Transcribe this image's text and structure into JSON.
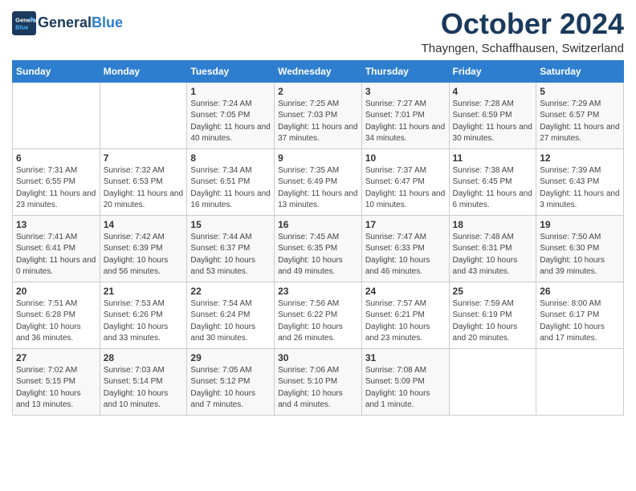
{
  "header": {
    "logo_line1": "General",
    "logo_line2": "Blue",
    "month": "October 2024",
    "location": "Thayngen, Schaffhausen, Switzerland"
  },
  "days_of_week": [
    "Sunday",
    "Monday",
    "Tuesday",
    "Wednesday",
    "Thursday",
    "Friday",
    "Saturday"
  ],
  "weeks": [
    [
      {
        "day": "",
        "info": ""
      },
      {
        "day": "",
        "info": ""
      },
      {
        "day": "1",
        "info": "Sunrise: 7:24 AM\nSunset: 7:05 PM\nDaylight: 11 hours and 40 minutes."
      },
      {
        "day": "2",
        "info": "Sunrise: 7:25 AM\nSunset: 7:03 PM\nDaylight: 11 hours and 37 minutes."
      },
      {
        "day": "3",
        "info": "Sunrise: 7:27 AM\nSunset: 7:01 PM\nDaylight: 11 hours and 34 minutes."
      },
      {
        "day": "4",
        "info": "Sunrise: 7:28 AM\nSunset: 6:59 PM\nDaylight: 11 hours and 30 minutes."
      },
      {
        "day": "5",
        "info": "Sunrise: 7:29 AM\nSunset: 6:57 PM\nDaylight: 11 hours and 27 minutes."
      }
    ],
    [
      {
        "day": "6",
        "info": "Sunrise: 7:31 AM\nSunset: 6:55 PM\nDaylight: 11 hours and 23 minutes."
      },
      {
        "day": "7",
        "info": "Sunrise: 7:32 AM\nSunset: 6:53 PM\nDaylight: 11 hours and 20 minutes."
      },
      {
        "day": "8",
        "info": "Sunrise: 7:34 AM\nSunset: 6:51 PM\nDaylight: 11 hours and 16 minutes."
      },
      {
        "day": "9",
        "info": "Sunrise: 7:35 AM\nSunset: 6:49 PM\nDaylight: 11 hours and 13 minutes."
      },
      {
        "day": "10",
        "info": "Sunrise: 7:37 AM\nSunset: 6:47 PM\nDaylight: 11 hours and 10 minutes."
      },
      {
        "day": "11",
        "info": "Sunrise: 7:38 AM\nSunset: 6:45 PM\nDaylight: 11 hours and 6 minutes."
      },
      {
        "day": "12",
        "info": "Sunrise: 7:39 AM\nSunset: 6:43 PM\nDaylight: 11 hours and 3 minutes."
      }
    ],
    [
      {
        "day": "13",
        "info": "Sunrise: 7:41 AM\nSunset: 6:41 PM\nDaylight: 11 hours and 0 minutes."
      },
      {
        "day": "14",
        "info": "Sunrise: 7:42 AM\nSunset: 6:39 PM\nDaylight: 10 hours and 56 minutes."
      },
      {
        "day": "15",
        "info": "Sunrise: 7:44 AM\nSunset: 6:37 PM\nDaylight: 10 hours and 53 minutes."
      },
      {
        "day": "16",
        "info": "Sunrise: 7:45 AM\nSunset: 6:35 PM\nDaylight: 10 hours and 49 minutes."
      },
      {
        "day": "17",
        "info": "Sunrise: 7:47 AM\nSunset: 6:33 PM\nDaylight: 10 hours and 46 minutes."
      },
      {
        "day": "18",
        "info": "Sunrise: 7:48 AM\nSunset: 6:31 PM\nDaylight: 10 hours and 43 minutes."
      },
      {
        "day": "19",
        "info": "Sunrise: 7:50 AM\nSunset: 6:30 PM\nDaylight: 10 hours and 39 minutes."
      }
    ],
    [
      {
        "day": "20",
        "info": "Sunrise: 7:51 AM\nSunset: 6:28 PM\nDaylight: 10 hours and 36 minutes."
      },
      {
        "day": "21",
        "info": "Sunrise: 7:53 AM\nSunset: 6:26 PM\nDaylight: 10 hours and 33 minutes."
      },
      {
        "day": "22",
        "info": "Sunrise: 7:54 AM\nSunset: 6:24 PM\nDaylight: 10 hours and 30 minutes."
      },
      {
        "day": "23",
        "info": "Sunrise: 7:56 AM\nSunset: 6:22 PM\nDaylight: 10 hours and 26 minutes."
      },
      {
        "day": "24",
        "info": "Sunrise: 7:57 AM\nSunset: 6:21 PM\nDaylight: 10 hours and 23 minutes."
      },
      {
        "day": "25",
        "info": "Sunrise: 7:59 AM\nSunset: 6:19 PM\nDaylight: 10 hours and 20 minutes."
      },
      {
        "day": "26",
        "info": "Sunrise: 8:00 AM\nSunset: 6:17 PM\nDaylight: 10 hours and 17 minutes."
      }
    ],
    [
      {
        "day": "27",
        "info": "Sunrise: 7:02 AM\nSunset: 5:15 PM\nDaylight: 10 hours and 13 minutes."
      },
      {
        "day": "28",
        "info": "Sunrise: 7:03 AM\nSunset: 5:14 PM\nDaylight: 10 hours and 10 minutes."
      },
      {
        "day": "29",
        "info": "Sunrise: 7:05 AM\nSunset: 5:12 PM\nDaylight: 10 hours and 7 minutes."
      },
      {
        "day": "30",
        "info": "Sunrise: 7:06 AM\nSunset: 5:10 PM\nDaylight: 10 hours and 4 minutes."
      },
      {
        "day": "31",
        "info": "Sunrise: 7:08 AM\nSunset: 5:09 PM\nDaylight: 10 hours and 1 minute."
      },
      {
        "day": "",
        "info": ""
      },
      {
        "day": "",
        "info": ""
      }
    ]
  ]
}
